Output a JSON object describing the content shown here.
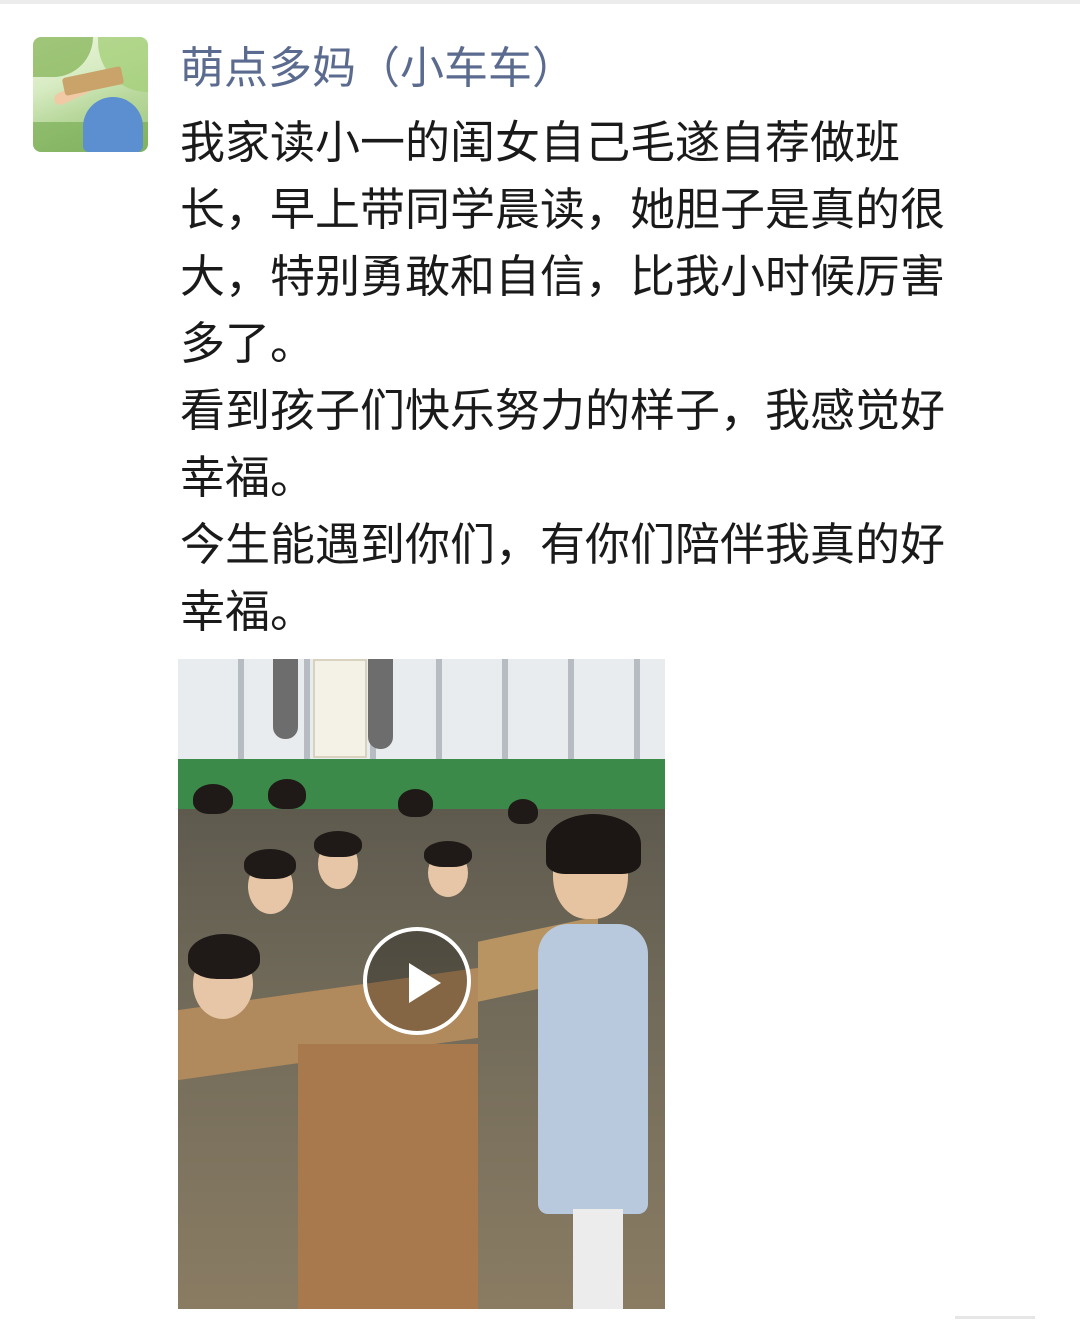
{
  "post": {
    "author": "萌点多妈（小车车）",
    "paragraphs": [
      {
        "lines": [
          "我家读小一的闺女自己毛遂自荐做班",
          "长，早上带同学晨读，她胆子是真的很",
          "大，特别勇敢和自信，比我小时候厉害",
          "多了。"
        ]
      },
      {
        "lines": [
          "看到孩子们快乐努力的样子，我感觉好",
          "幸福。"
        ]
      },
      {
        "lines": [
          "今生能遇到你们，有你们陪伴我真的好",
          "幸福。"
        ]
      }
    ],
    "media": {
      "type": "video",
      "icon": "play-icon"
    }
  },
  "colors": {
    "author_name": "#5b6b8f",
    "text": "#1a1a1a",
    "background": "#ffffff"
  }
}
